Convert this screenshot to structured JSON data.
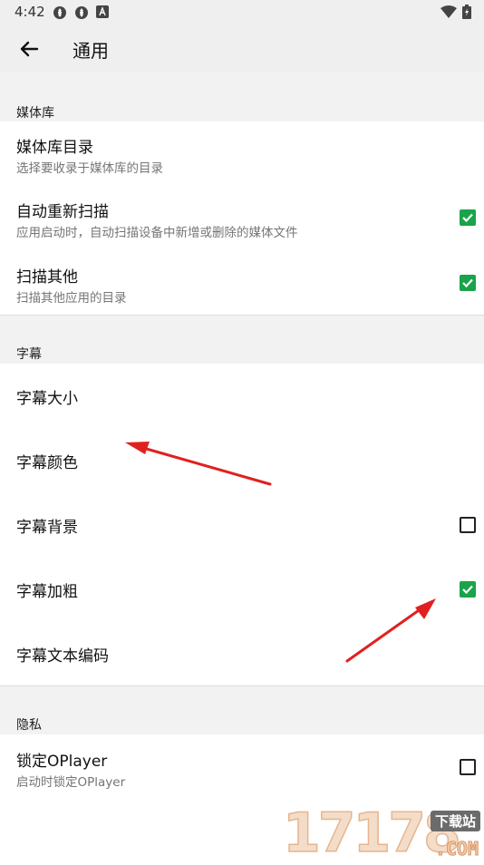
{
  "status_bar": {
    "time": "4:42",
    "left_icons": [
      "sync-icon",
      "sync-icon",
      "a-badge-icon"
    ],
    "right_icons": [
      "wifi-icon",
      "battery-charging-icon"
    ]
  },
  "app_bar": {
    "title": "通用",
    "back_icon": "arrow-left-icon"
  },
  "sections": {
    "media": {
      "header": "媒体库",
      "items": [
        {
          "title": "媒体库目录",
          "summary": "选择要收录于媒体库的目录"
        },
        {
          "title": "自动重新扫描",
          "summary": "应用启动时，自动扫描设备中新增或删除的媒体文件",
          "checked": true
        },
        {
          "title": "扫描其他",
          "summary": "扫描其他应用的目录",
          "checked": true
        }
      ]
    },
    "subtitle": {
      "header": "字幕",
      "items": [
        {
          "title": "字幕大小"
        },
        {
          "title": "字幕颜色"
        },
        {
          "title": "字幕背景",
          "checked": false
        },
        {
          "title": "字幕加粗",
          "checked": true
        },
        {
          "title": "字幕文本编码"
        }
      ]
    },
    "privacy": {
      "header": "隐私",
      "items": [
        {
          "title": "锁定OPlayer",
          "summary": "启动时锁定OPlayer",
          "checked": false
        }
      ]
    }
  },
  "colors": {
    "checkbox_checked": "#1aa34a",
    "annotation_arrow": "#e02020",
    "header_background": "#efefef"
  },
  "watermark": {
    "digits": "17178",
    "tag": "下载站",
    "domain": ".COM"
  }
}
